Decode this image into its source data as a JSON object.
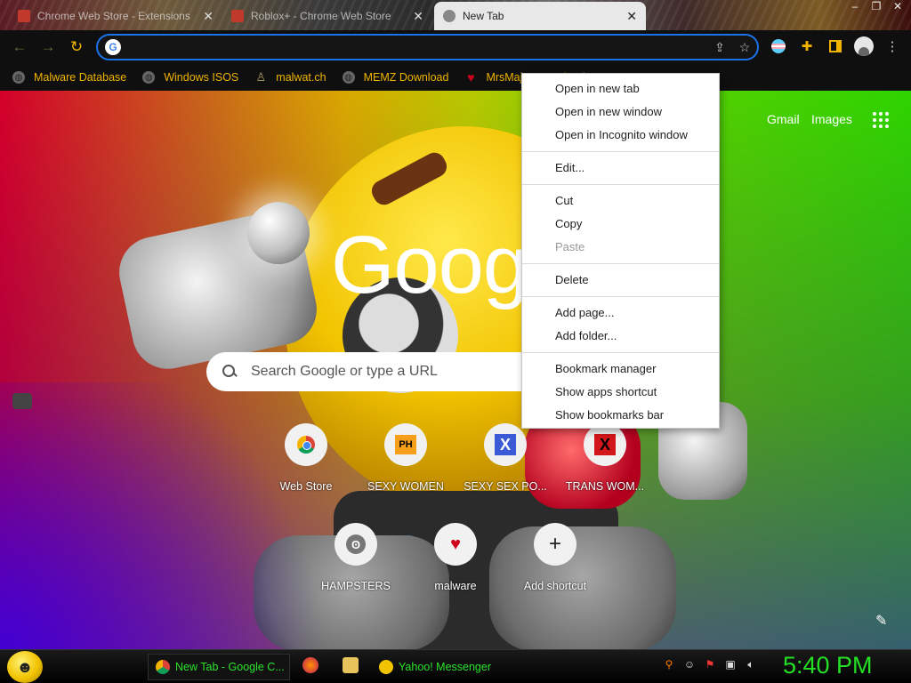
{
  "colors": {
    "accent": "#f0b400",
    "taskbar_text": "#29e329",
    "clock": "#24e024",
    "omnibox_border": "#1a73e8"
  },
  "tabs": [
    {
      "title": "Chrome Web Store - Extensions",
      "icon": "chrome-store-icon",
      "active": false
    },
    {
      "title": "Roblox+ - Chrome Web Store",
      "icon": "chrome-store-icon",
      "active": false
    },
    {
      "title": "New Tab",
      "icon": "chrome-icon",
      "active": true
    }
  ],
  "window_controls": [
    "minimize-icon",
    "restore-icon",
    "close-icon"
  ],
  "toolbar": {
    "omnibox_value": "",
    "icons": [
      "back-icon",
      "forward-icon",
      "reload-icon",
      "share-icon",
      "star-icon",
      "profile-flag-icon",
      "extensions-icon",
      "side-panel-icon",
      "avatar-icon",
      "menu-icon"
    ]
  },
  "bookmarks": [
    {
      "label": "Malware Database",
      "icon": "globe-icon"
    },
    {
      "label": "Windows ISOS",
      "icon": "globe-icon"
    },
    {
      "label": "malwat.ch",
      "icon": "person-icon"
    },
    {
      "label": "MEMZ Download",
      "icon": "globe-icon"
    },
    {
      "label": "MrsMajor Download",
      "icon": "heart-icon"
    }
  ],
  "ntp": {
    "gmail": "Gmail",
    "images": "Images",
    "logo": "Google",
    "search_placeholder": "Search Google or type a URL",
    "shortcuts": [
      {
        "label": "Web Store",
        "icon": "webstore-icon"
      },
      {
        "label": "SEXY WOMEN",
        "icon": "ph-icon",
        "glyph": "PH"
      },
      {
        "label": "SEXY SEX PO...",
        "icon": "x-blue-icon",
        "glyph": "X"
      },
      {
        "label": "TRANS WOM...",
        "icon": "x-red-icon",
        "glyph": "X"
      },
      {
        "label": "HAMPSTERS",
        "icon": "hamster-icon"
      },
      {
        "label": "malware",
        "icon": "heart-icon"
      },
      {
        "label": "Add shortcut",
        "icon": "plus-icon",
        "glyph": "+"
      }
    ]
  },
  "context_menu": {
    "groups": [
      [
        {
          "label": "Open in new tab",
          "enabled": true
        },
        {
          "label": "Open in new window",
          "enabled": true
        },
        {
          "label": "Open in Incognito window",
          "enabled": true
        }
      ],
      [
        {
          "label": "Edit...",
          "enabled": true
        }
      ],
      [
        {
          "label": "Cut",
          "enabled": true
        },
        {
          "label": "Copy",
          "enabled": true
        },
        {
          "label": "Paste",
          "enabled": false
        }
      ],
      [
        {
          "label": "Delete",
          "enabled": true
        }
      ],
      [
        {
          "label": "Add page...",
          "enabled": true
        },
        {
          "label": "Add folder...",
          "enabled": true
        }
      ],
      [
        {
          "label": "Bookmark manager",
          "enabled": true
        },
        {
          "label": "Show apps shortcut",
          "enabled": true
        },
        {
          "label": "Show bookmarks bar",
          "enabled": true
        }
      ]
    ]
  },
  "taskbar": {
    "tasks": [
      {
        "label": "New Tab - Google C...",
        "icon": "chrome-icon",
        "active": true
      },
      {
        "label": "Yahoo! Messenger",
        "icon": "yahoo-messenger-icon",
        "active": false
      }
    ],
    "quick_launch": [
      "firefox-icon",
      "folder-icon"
    ],
    "tray": [
      "search-icon",
      "messenger-icon",
      "flag-icon",
      "network-icon",
      "volume-icon"
    ],
    "clock": "5:40 PM"
  }
}
